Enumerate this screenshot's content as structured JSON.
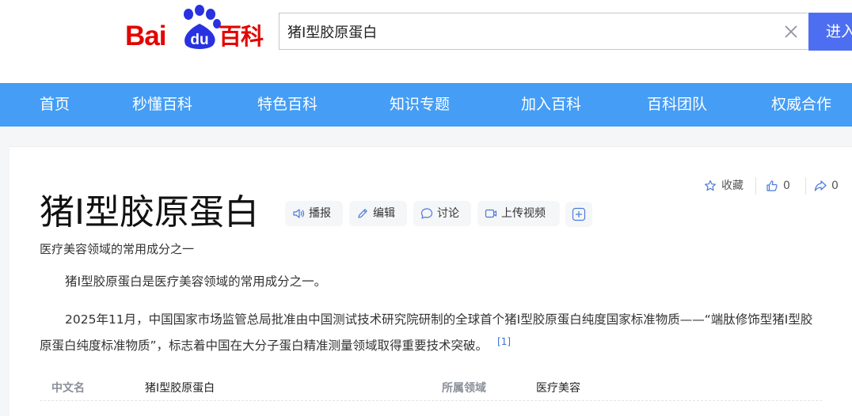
{
  "logo": {
    "text_bai": "Bai",
    "text_du": "du",
    "text_baike": "百科",
    "brand_red": "#e10601",
    "brand_blue": "#2932e1"
  },
  "search": {
    "value": "猪Ⅰ型胶原蛋白",
    "button_label": "进入",
    "clear_icon": "close-icon"
  },
  "nav": {
    "bg": "#459df5",
    "items": [
      "首页",
      "秒懂百科",
      "特色百科",
      "知识专题",
      "加入百科",
      "百科团队",
      "权威合作"
    ]
  },
  "entry": {
    "title": "猪Ⅰ型胶原蛋白",
    "subtitle": "医疗美容领域的常用成分之一",
    "tools": {
      "broadcast": "播报",
      "edit": "编辑",
      "discuss": "讨论",
      "upload_video": "上传视频"
    },
    "actions": {
      "collect": "收藏",
      "like_count": "0",
      "share_count": "0"
    },
    "paragraphs": [
      "猪Ⅰ型胶原蛋白是医疗美容领域的常用成分之一。",
      "2025年11月，中国国家市场监管总局批准由中国测试技术研究院研制的全球首个猪Ⅰ型胶原蛋白纯度国家标准物质——“端肽修饰型猪Ⅰ型胶原蛋白纯度标准物质”，标志着中国在大分子蛋白精准测量领域取得重要技术突破。"
    ],
    "reference": "[1]",
    "infobox": [
      {
        "key": "中文名",
        "value": "猪Ⅰ型胶原蛋白"
      },
      {
        "key": "所属领域",
        "value": "医疗美容"
      }
    ]
  }
}
